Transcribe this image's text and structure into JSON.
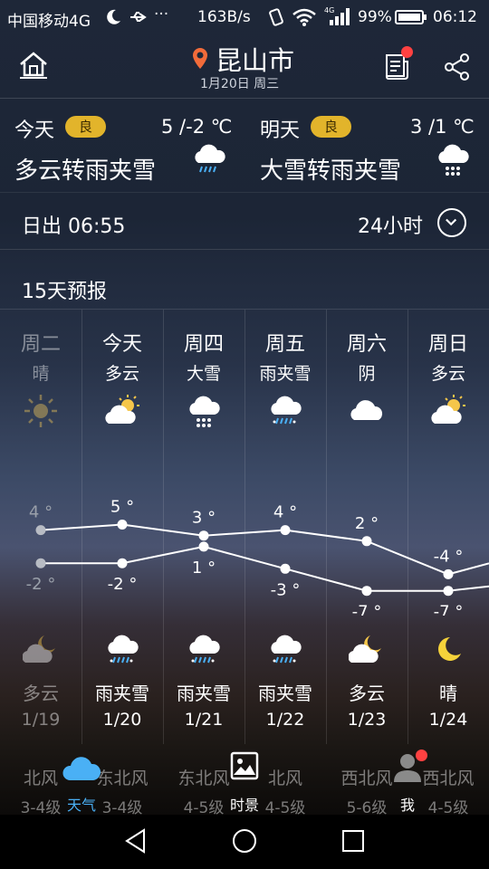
{
  "status_bar": {
    "carrier": "中国移动4G",
    "speed": "163B/s",
    "battery": "99%",
    "time": "06:12",
    "icons": [
      "moon-icon",
      "usb-icon",
      "more-icon",
      "vibrate-icon",
      "wifi-icon",
      "signal-icon",
      "battery-icon"
    ]
  },
  "header": {
    "city": "昆山市",
    "date": "1月20日 周三",
    "icons": [
      "home-icon",
      "location-pin-icon",
      "news-icon",
      "share-icon"
    ],
    "notification_color": "#ff4141"
  },
  "today": {
    "label": "今天",
    "aqi": "良",
    "temp": "5 /-2 ℃",
    "condition": "多云转雨夹雪",
    "icon": "sleet-icon"
  },
  "tomorrow": {
    "label": "明天",
    "aqi": "良",
    "temp": "3 /1 ℃",
    "condition": "大雪转雨夹雪",
    "icon": "heavy-snow-icon"
  },
  "sunrise": "日出 06:55",
  "hours24": "24小时",
  "forecast_title": "15天预报",
  "accent_color": "#e2b42b",
  "days": [
    {
      "weekday": "周二",
      "day_cond": "晴",
      "day_icon": "sunny-icon",
      "night_icon": "moon-cloud-icon",
      "night_cond": "多云",
      "date": "1/19",
      "wind_dir": "北风",
      "wind_level": "3-4级",
      "past": true
    },
    {
      "weekday": "今天",
      "day_cond": "多云",
      "day_icon": "partly-cloudy-icon",
      "night_icon": "sleet-icon",
      "night_cond": "雨夹雪",
      "date": "1/20",
      "wind_dir": "东北风",
      "wind_level": "3-4级",
      "past": false
    },
    {
      "weekday": "周四",
      "day_cond": "大雪",
      "day_icon": "heavy-snow-icon",
      "night_icon": "sleet-icon",
      "night_cond": "雨夹雪",
      "date": "1/21",
      "wind_dir": "东北风",
      "wind_level": "4-5级",
      "past": false
    },
    {
      "weekday": "周五",
      "day_cond": "雨夹雪",
      "day_icon": "sleet-icon",
      "night_icon": "sleet-icon",
      "night_cond": "雨夹雪",
      "date": "1/22",
      "wind_dir": "北风",
      "wind_level": "4-5级",
      "past": false
    },
    {
      "weekday": "周六",
      "day_cond": "阴",
      "day_icon": "cloudy-icon",
      "night_icon": "moon-cloud-icon",
      "night_cond": "多云",
      "date": "1/23",
      "wind_dir": "西北风",
      "wind_level": "5-6级",
      "past": false
    },
    {
      "weekday": "周日",
      "day_cond": "多云",
      "day_icon": "partly-cloudy-icon",
      "night_icon": "moon-icon",
      "night_cond": "晴",
      "date": "1/24",
      "wind_dir": "西北风",
      "wind_level": "4-5级",
      "past": false
    }
  ],
  "chart_data": {
    "type": "line",
    "categories": [
      "1/19",
      "1/20",
      "1/21",
      "1/22",
      "1/23",
      "1/24"
    ],
    "series": [
      {
        "values": [
          4,
          5,
          3,
          4,
          2,
          -4
        ],
        "labels": [
          "4 °",
          "5 °",
          "3 °",
          "4 °",
          "2 °",
          "-4 °"
        ]
      },
      {
        "values": [
          -2,
          -2,
          1,
          -3,
          -7,
          -7
        ],
        "labels": [
          "-2 °",
          "-2 °",
          "1 °",
          "-3 °",
          "-7 °",
          "-7 °"
        ]
      }
    ]
  },
  "tabs": [
    {
      "label": "天气",
      "icon": "cloud-icon",
      "active": true
    },
    {
      "label": "时景",
      "icon": "photo-icon",
      "active": false
    },
    {
      "label": "我",
      "icon": "user-icon",
      "active": false
    }
  ],
  "tab_active_color": "#4ab0f5"
}
